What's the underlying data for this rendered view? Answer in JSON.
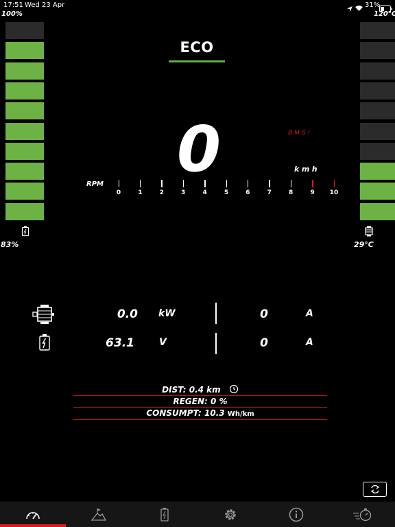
{
  "status_bar": {
    "time": "17:51",
    "date": "Wed 23 Apr",
    "battery_percent": "31%"
  },
  "left_gauge": {
    "top_label": "100%",
    "bottom_label": "83%",
    "icon": "battery-charge-icon",
    "segments_total": 10,
    "segments_lit": 9,
    "color": "#6cb244"
  },
  "right_gauge": {
    "top_label": "120°C",
    "bottom_label": "29°C",
    "icon": "motor-temperature-icon",
    "segments_total": 10,
    "segments_lit": 3,
    "color": "#6cb244"
  },
  "mode": {
    "label": "ECO",
    "accent": "#5fb040"
  },
  "speed": {
    "value": "0",
    "unit": "kmh",
    "bms_label": "BMS!",
    "warning_color": "#e0181d"
  },
  "rpm": {
    "label": "RPM",
    "ticks": [
      "0",
      "1",
      "2",
      "3",
      "4",
      "5",
      "6",
      "7",
      "8",
      "9",
      "10"
    ],
    "redline_from": 9
  },
  "readings": {
    "motor": {
      "icon": "motor-icon",
      "power": "0.0",
      "power_unit": "kW",
      "current": "0",
      "current_unit": "A"
    },
    "battery": {
      "icon": "battery-icon",
      "voltage": "63.1",
      "voltage_unit": "V",
      "current": "0",
      "current_unit": "A"
    }
  },
  "stats": {
    "dist": "DIST: 0.4 km",
    "regen": "REGEN: 0 %",
    "consumpt": "CONSUMPT: 10.3",
    "consumpt_unit": "Wh/km"
  },
  "tabs": [
    {
      "icon": "speedometer-icon",
      "active": true
    },
    {
      "icon": "mountain-flag-icon",
      "active": false
    },
    {
      "icon": "battery-tab-icon",
      "active": false
    },
    {
      "icon": "gear-icon",
      "active": false
    },
    {
      "icon": "info-icon",
      "active": false
    },
    {
      "icon": "fast-stopwatch-icon",
      "active": false
    }
  ]
}
